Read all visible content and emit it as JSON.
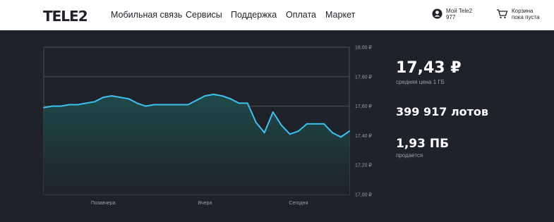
{
  "header": {
    "logo": "TELE2",
    "nav": [
      "Мобильная связь",
      "Сервисы",
      "Поддержка",
      "Оплата",
      "Маркет"
    ],
    "account": {
      "icon": "user-icon",
      "line1": "Мой Tele2",
      "line2": "977"
    },
    "cart": {
      "icon": "cart-icon",
      "line1": "Корзина",
      "line2": "пока пуста"
    }
  },
  "colors": {
    "bg": "#1f2229",
    "line": "#3dc2f0",
    "grid": "#4a4f57",
    "fill": "#1f4a4a"
  },
  "stats": {
    "price": "17,43 ₽",
    "price_label": "средняя цена 1 ГБ",
    "lots": "399 917 лотов",
    "volume": "1,93 ПБ",
    "volume_label": "продается"
  },
  "chart_data": {
    "type": "area",
    "ylim": [
      17.0,
      18.0
    ],
    "y_tick_labels": [
      "18,00 ₽",
      "17,80 ₽",
      "17,60 ₽",
      "17,40 ₽",
      "17,20 ₽",
      "17,00 ₽"
    ],
    "x_tick_labels": [
      "Позавчера",
      "Вчера",
      "Сегодня"
    ],
    "x_tick_index": [
      7,
      19,
      30
    ],
    "grid": true,
    "values": [
      17.59,
      17.6,
      17.6,
      17.61,
      17.61,
      17.62,
      17.63,
      17.66,
      17.67,
      17.66,
      17.65,
      17.62,
      17.6,
      17.61,
      17.61,
      17.61,
      17.61,
      17.61,
      17.64,
      17.67,
      17.68,
      17.67,
      17.65,
      17.62,
      17.62,
      17.49,
      17.42,
      17.56,
      17.47,
      17.41,
      17.43,
      17.48,
      17.48,
      17.48,
      17.42,
      17.39,
      17.43
    ]
  }
}
